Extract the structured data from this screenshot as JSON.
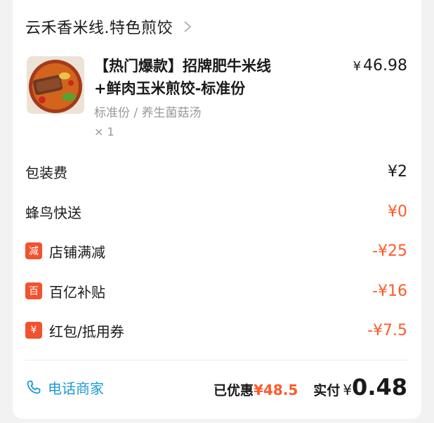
{
  "store": {
    "name": "云禾香米线.特色煎饺"
  },
  "item": {
    "title_line1": "【热门爆款】招牌肥牛米线",
    "title_line2": "+鲜肉玉米煎饺-标准份",
    "price_symbol": "¥",
    "price": "46.98",
    "spec": "标准份 / 养生菌菇汤",
    "qty": "× 1",
    "image": "food-bowl-image"
  },
  "fees": [
    {
      "label": "包装费",
      "value": "¥2",
      "type": "normal"
    },
    {
      "label": "蜂鸟快送",
      "value": "¥0",
      "type": "red"
    },
    {
      "label": "店铺满减",
      "badge": "减",
      "value": "-¥25",
      "type": "red"
    },
    {
      "label": "百亿补贴",
      "badge": "百",
      "value": "-¥16",
      "type": "red"
    },
    {
      "label": "红包/抵用券",
      "badge": "¥",
      "value": "-¥7.5",
      "type": "red"
    }
  ],
  "footer": {
    "call_label": "电话商家",
    "saved_label": "已优惠",
    "saved_value": "¥48.5",
    "paid_label": "实付",
    "paid_symbol": "¥",
    "paid_value": "0.48"
  },
  "colors": {
    "accent_red": "#ff5a2a",
    "badge_red": "#f2522e",
    "call_blue": "#1c9ad6"
  }
}
